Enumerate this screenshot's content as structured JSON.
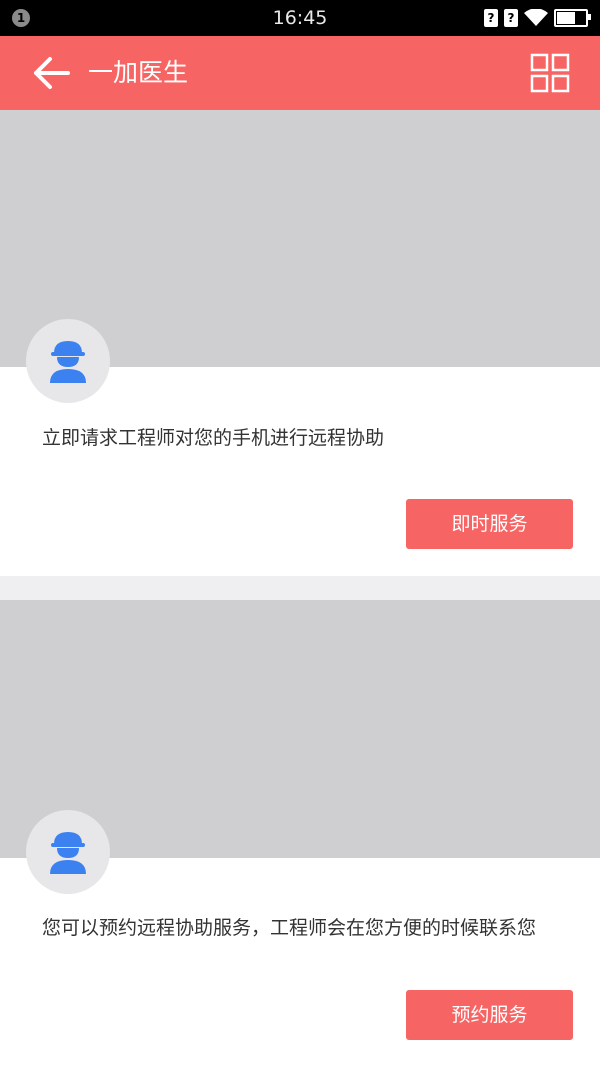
{
  "status_bar": {
    "notification_count": "1",
    "time": "16:45",
    "icons": [
      "sim1-icon",
      "sim2-icon",
      "wifi-icon",
      "battery-icon"
    ],
    "sim1_label": "?",
    "sim2_label": "?"
  },
  "app_bar": {
    "title": "一加医生",
    "back_icon": "arrow-left-icon",
    "menu_icon": "grid-icon",
    "background": "#f76464"
  },
  "cards": [
    {
      "description": "立即请求工程师对您的手机进行远程协助",
      "button_label": "即时服务",
      "avatar_icon": "engineer-icon"
    },
    {
      "description": "您可以预约远程协助服务，工程师会在您方便的时候联系您",
      "button_label": "预约服务",
      "avatar_icon": "engineer-icon"
    }
  ],
  "colors": {
    "accent": "#f76464",
    "icon_blue": "#3b82f0",
    "banner": "#cfcfd1"
  }
}
